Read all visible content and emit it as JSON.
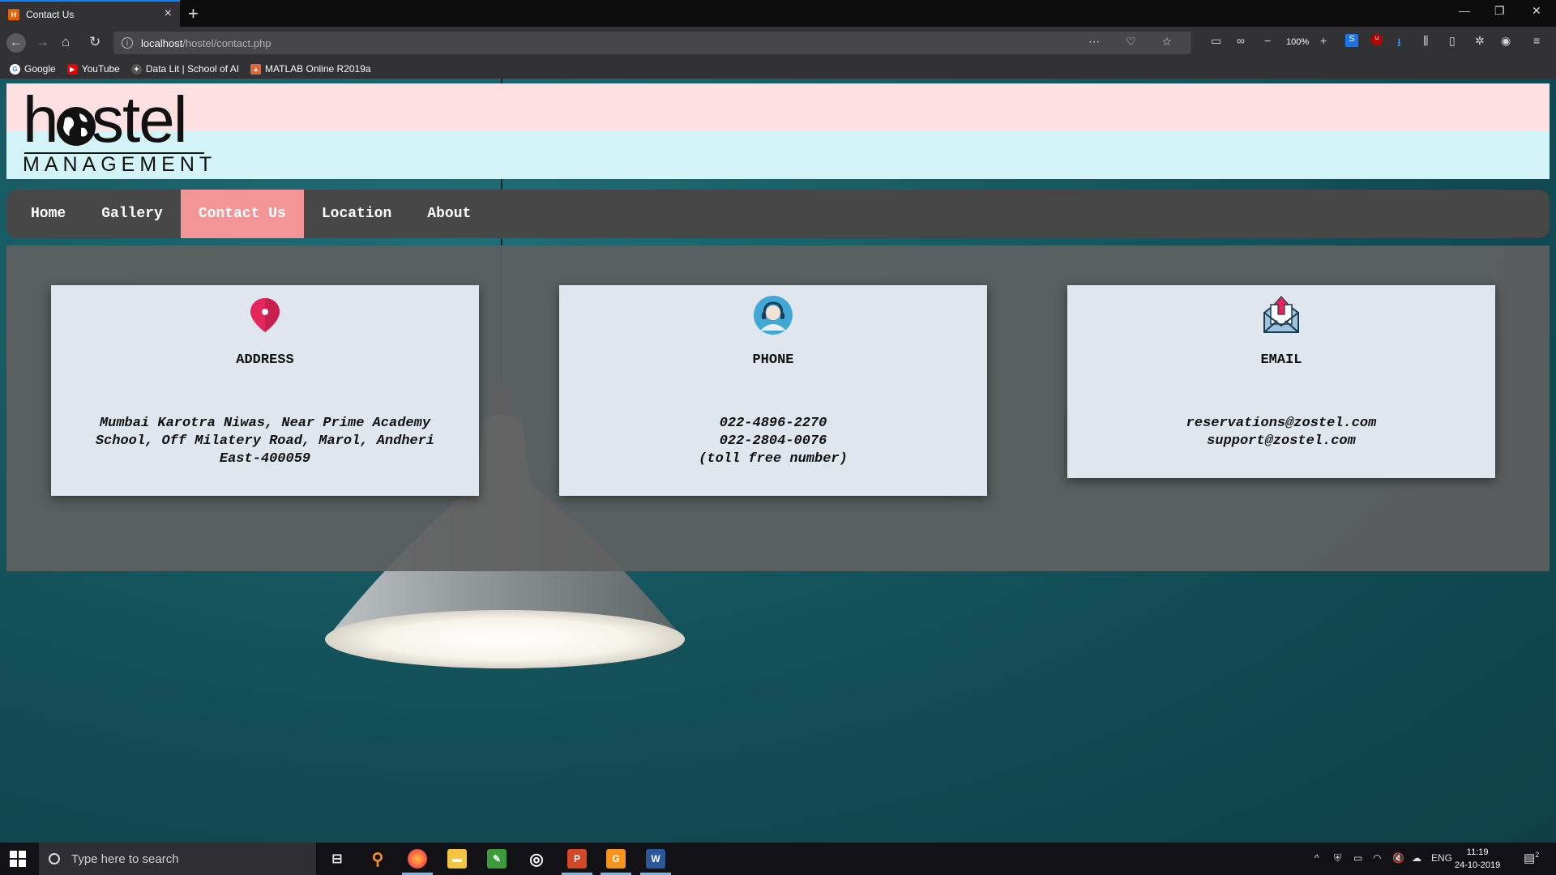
{
  "browser": {
    "tab_title": "Contact Us",
    "url_host": "localhost",
    "url_path": "/hostel/contact.php",
    "zoom": "100%",
    "bookmarks": [
      "Google",
      "YouTube",
      "Data Lit | School of AI",
      "MATLAB Online R2019a"
    ]
  },
  "site": {
    "logo_word": "hostel",
    "logo_sub": "MANAGEMENT",
    "nav": [
      "Home",
      "Gallery",
      "Contact Us",
      "Location",
      "About"
    ],
    "active_nav": "Contact Us"
  },
  "cards": [
    {
      "title": "ADDRESS",
      "lines": [
        "Mumbai Karotra Niwas, Near Prime Academy",
        "School, Off Milatery Road, Marol, Andheri",
        "East-400059"
      ],
      "icon": "location-pin-icon"
    },
    {
      "title": "PHONE",
      "lines": [
        "022-4896-2270",
        "022-2804-0076",
        "(toll free number)"
      ],
      "icon": "customer-support-icon"
    },
    {
      "title": "EMAIL",
      "lines": [
        "reservations@zostel.com",
        "support@zostel.com"
      ],
      "icon": "envelope-upload-icon"
    }
  ],
  "taskbar": {
    "search_placeholder": "Type here to search",
    "lang": "ENG",
    "time": "11:19",
    "date": "24-10-2019",
    "notifications": "2"
  },
  "colors": {
    "active_nav": "#f39597",
    "menu_bg": "#474747",
    "header_top": "#fde0e2",
    "header_bottom": "#d3f4f6"
  }
}
